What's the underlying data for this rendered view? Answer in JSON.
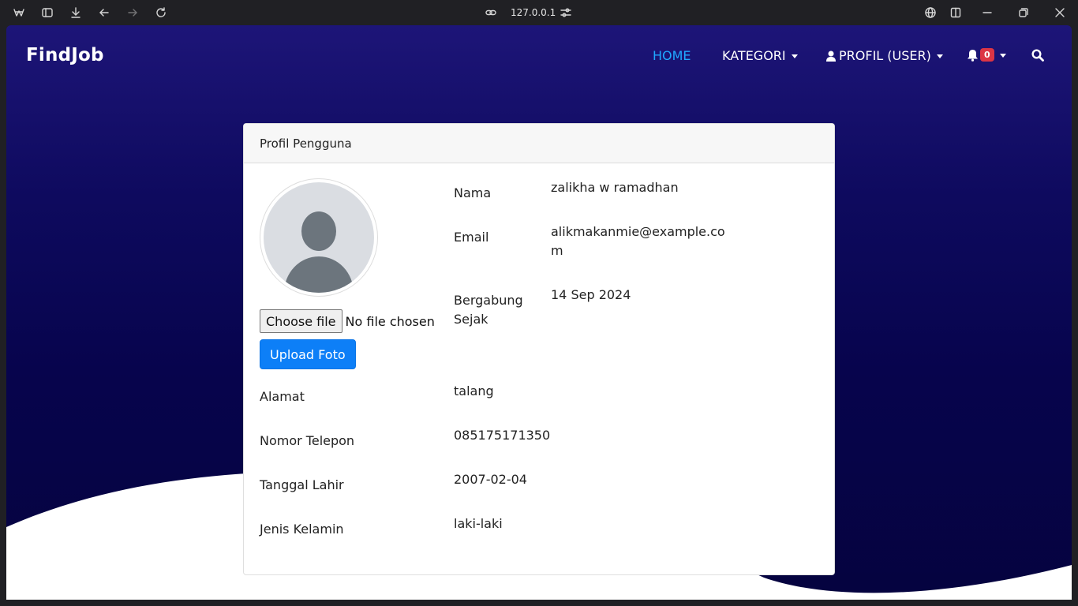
{
  "browser": {
    "url": "127.0.0.1",
    "icons": [
      "app-logo-icon",
      "sidebar-toggle-icon",
      "download-icon",
      "back-icon",
      "forward-icon",
      "reload-icon",
      "link-icon",
      "site-settings-icon",
      "translate-icon",
      "split-view-icon",
      "minimize-icon",
      "restore-icon",
      "close-icon"
    ]
  },
  "navbar": {
    "brand": "FindJob",
    "home": "HOME",
    "kategori": "KATEGORI",
    "profil": "PROFIL (USER)",
    "notification_count": "0"
  },
  "card": {
    "title": "Profil Pengguna",
    "file_button": "Choose file",
    "file_status": "No file chosen",
    "upload_button": "Upload Foto",
    "fields": [
      {
        "label": "Nama",
        "value": "zalikha w ramadhan"
      },
      {
        "label": "Email",
        "value_line1": "alikmakanmie@example.co",
        "value_line2": "m"
      },
      {
        "label_line1": "Bergabung",
        "label_line2": "Sejak",
        "value": "14 Sep 2024"
      },
      {
        "label": "Alamat",
        "value": "talang"
      },
      {
        "label": "Nomor Telepon",
        "value": "085175171350"
      },
      {
        "label": "Tanggal Lahir",
        "value": "2007-02-04"
      },
      {
        "label": "Jenis Kelamin",
        "value": "laki-laki"
      }
    ]
  },
  "colors": {
    "nav_active": "#1fa8ff",
    "primary": "#0d7ff7",
    "badge": "#dc3545",
    "background_dark": "#07044d"
  }
}
